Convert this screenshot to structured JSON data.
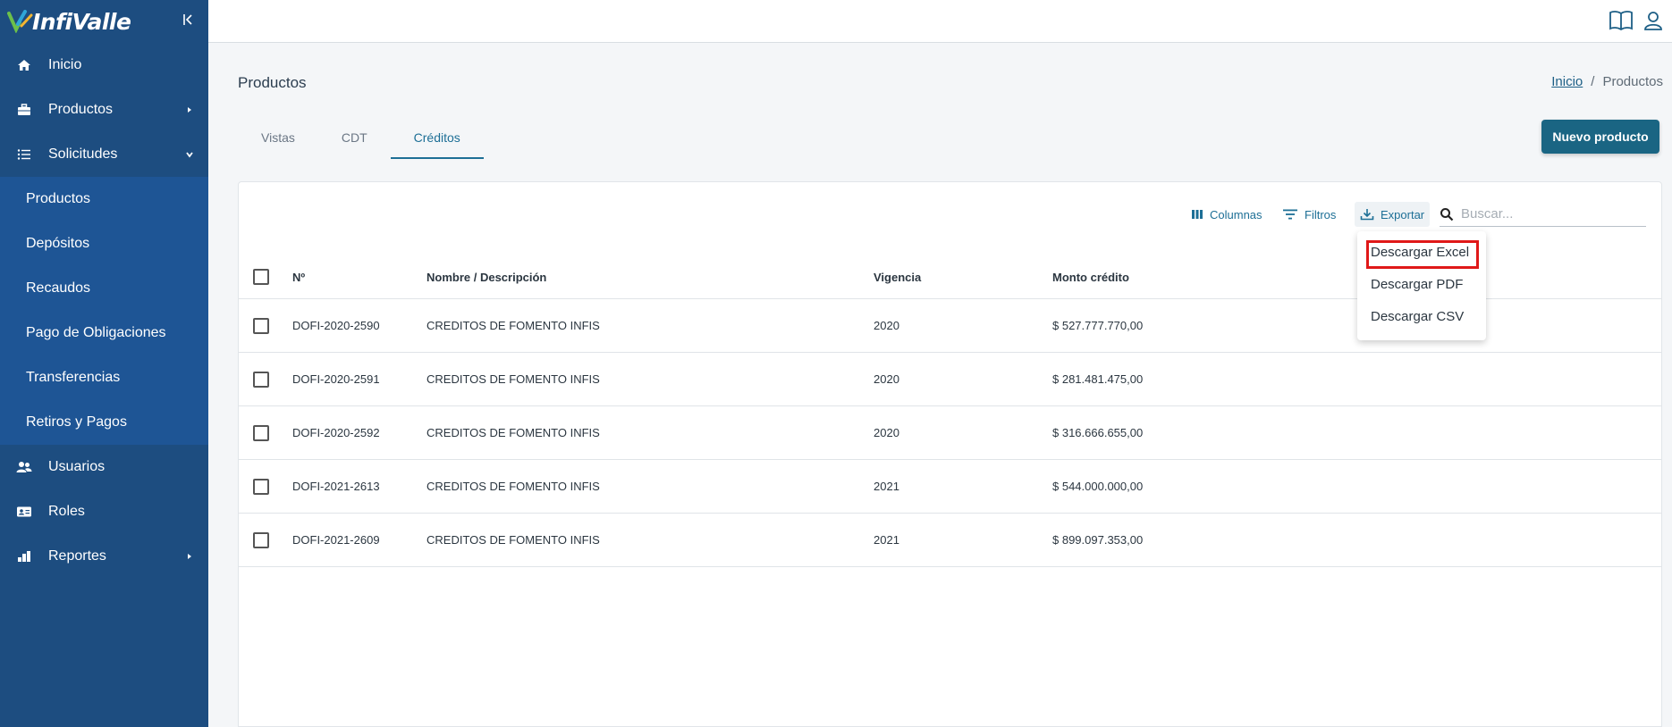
{
  "app": {
    "logo_text": "InfiValle"
  },
  "sidebar": {
    "items": [
      {
        "label": "Inicio",
        "icon": "home-icon"
      },
      {
        "label": "Productos",
        "icon": "briefcase-icon"
      },
      {
        "label": "Solicitudes",
        "icon": "list-icon"
      }
    ],
    "submenu": [
      "Productos",
      "Depósitos",
      "Recaudos",
      "Pago de Obligaciones",
      "Transferencias",
      "Retiros y Pagos"
    ],
    "items_after": [
      {
        "label": "Usuarios",
        "icon": "users-icon"
      },
      {
        "label": "Roles",
        "icon": "id-card-icon"
      },
      {
        "label": "Reportes",
        "icon": "chart-icon"
      }
    ]
  },
  "page": {
    "title": "Productos",
    "breadcrumb": {
      "home": "Inicio",
      "separator": "/",
      "current": "Productos"
    },
    "tabs": [
      "Vistas",
      "CDT",
      "Créditos"
    ],
    "active_tab": "Créditos",
    "new_button": "Nuevo producto"
  },
  "toolbar": {
    "columns": "Columnas",
    "filters": "Filtros",
    "export": "Exportar",
    "search_placeholder": "Buscar..."
  },
  "export_menu": {
    "items": [
      "Descargar Excel",
      "Descargar PDF",
      "Descargar CSV"
    ],
    "highlighted": "Descargar Excel"
  },
  "table": {
    "headers": [
      "Nº",
      "Nombre / Descripción",
      "Vigencia",
      "Monto crédito"
    ],
    "rows": [
      {
        "id": "DOFI-2020-2590",
        "name": "CREDITOS DE FOMENTO INFIS",
        "year": "2020",
        "amount": "$ 527.777.770,00"
      },
      {
        "id": "DOFI-2020-2591",
        "name": "CREDITOS DE FOMENTO INFIS",
        "year": "2020",
        "amount": "$ 281.481.475,00"
      },
      {
        "id": "DOFI-2020-2592",
        "name": "CREDITOS DE FOMENTO INFIS",
        "year": "2020",
        "amount": "$ 316.666.655,00"
      },
      {
        "id": "DOFI-2021-2613",
        "name": "CREDITOS DE FOMENTO INFIS",
        "year": "2021",
        "amount": "$ 544.000.000,00"
      },
      {
        "id": "DOFI-2021-2609",
        "name": "CREDITOS DE FOMENTO INFIS",
        "year": "2021",
        "amount": "$ 899.097.353,00"
      }
    ]
  },
  "colors": {
    "sidebar": "#1d4d80",
    "submenu": "#1e5595",
    "accent": "#1d6f96",
    "primary_button": "#1a6583",
    "highlight_box": "#e01818"
  }
}
